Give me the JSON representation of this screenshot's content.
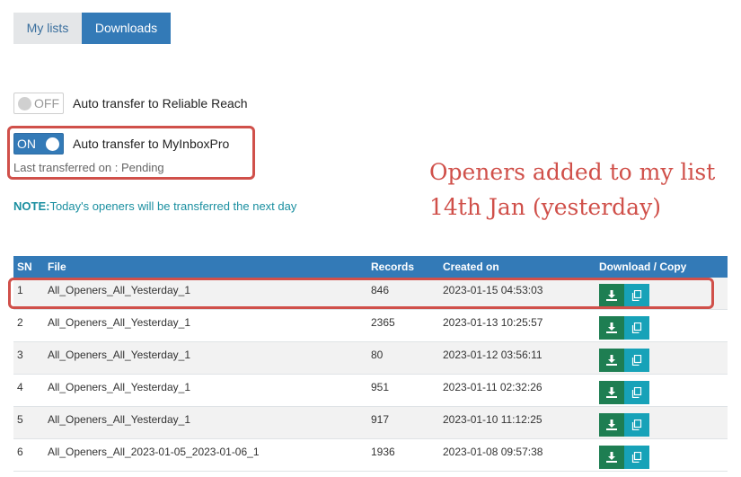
{
  "tabs": [
    {
      "label": "My lists",
      "active": false
    },
    {
      "label": "Downloads",
      "active": true
    }
  ],
  "toggles": [
    {
      "state": "OFF",
      "label": "Auto transfer to Reliable Reach"
    },
    {
      "state": "ON",
      "label": "Auto transfer to MyInboxPro"
    }
  ],
  "last_transferred": "Last transferred on : Pending",
  "note": {
    "prefix": "NOTE:",
    "text": "Today's openers will be transferred the next day"
  },
  "annotation": {
    "line1": "Openers added to my list",
    "line2": "14th Jan (yesterday)"
  },
  "table": {
    "headers": {
      "sn": "SN",
      "file": "File",
      "records": "Records",
      "created": "Created on",
      "actions": "Download / Copy"
    },
    "rows": [
      {
        "sn": "1",
        "file": "All_Openers_All_Yesterday_1",
        "records": "846",
        "created": "2023-01-15 04:53:03"
      },
      {
        "sn": "2",
        "file": "All_Openers_All_Yesterday_1",
        "records": "2365",
        "created": "2023-01-13 10:25:57"
      },
      {
        "sn": "3",
        "file": "All_Openers_All_Yesterday_1",
        "records": "80",
        "created": "2023-01-12 03:56:11"
      },
      {
        "sn": "4",
        "file": "All_Openers_All_Yesterday_1",
        "records": "951",
        "created": "2023-01-11 02:32:26"
      },
      {
        "sn": "5",
        "file": "All_Openers_All_Yesterday_1",
        "records": "917",
        "created": "2023-01-10 11:12:25"
      },
      {
        "sn": "6",
        "file": "All_Openers_All_2023-01-05_2023-01-06_1",
        "records": "1936",
        "created": "2023-01-08 09:57:38"
      }
    ]
  },
  "colors": {
    "primary": "#337ab7",
    "annotation_red": "#d0504a",
    "download_button": "#1e7e52",
    "copy_button": "#17a2b8",
    "note_teal": "#1a8fa0"
  },
  "icons": {
    "download": "download-icon",
    "copy": "copy-icon"
  }
}
